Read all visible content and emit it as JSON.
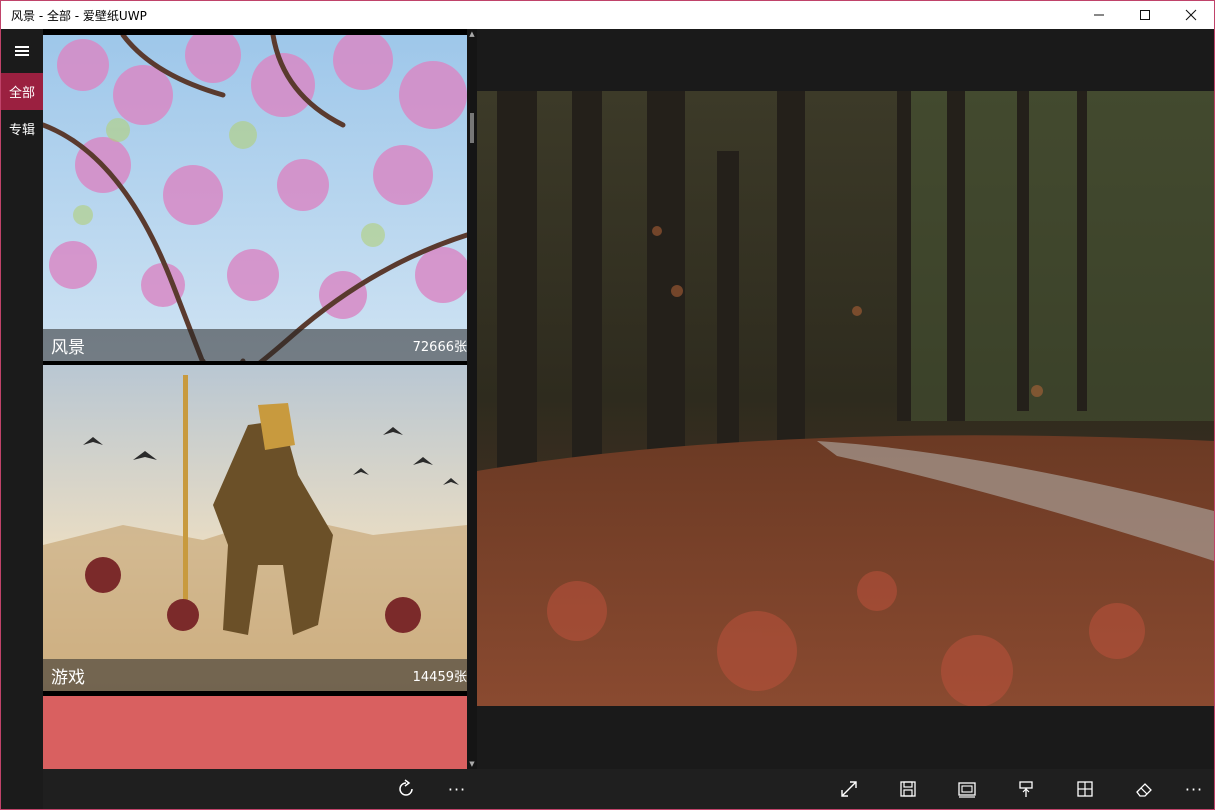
{
  "window": {
    "title": "风景 - 全部 - 爱壁纸UWP",
    "controls": [
      "minimize",
      "maximize",
      "close"
    ]
  },
  "nav": {
    "items": [
      {
        "label": "全部",
        "active": true
      },
      {
        "label": "专辑",
        "active": false
      }
    ]
  },
  "categories": [
    {
      "name": "风景",
      "count": "72666张"
    },
    {
      "name": "游戏",
      "count": "14459张"
    },
    {
      "name": "",
      "count": "",
      "color": "#d96060"
    }
  ],
  "toolbar_left": {
    "refresh_icon": "refresh-icon",
    "more": "···"
  },
  "toolbar_right": {
    "icons": [
      "fullscreen-icon",
      "save-icon",
      "set-wallpaper-icon",
      "pin-icon",
      "tile-icon",
      "eraser-icon"
    ],
    "more": "···"
  },
  "colors": {
    "accent": "#9b2040",
    "window_border": "#c0436a",
    "background": "#1a1a1a"
  }
}
